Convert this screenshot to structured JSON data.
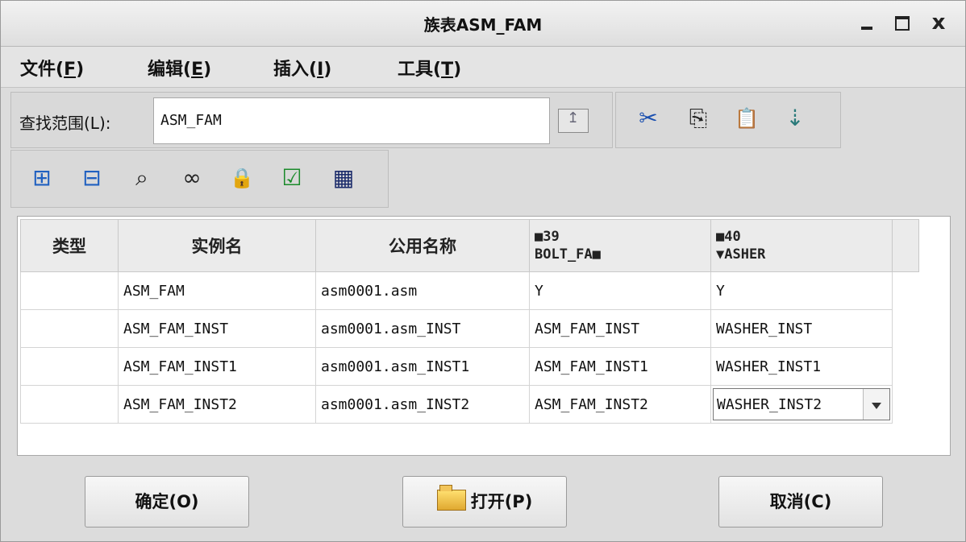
{
  "window": {
    "title": "族表ASM_FAM"
  },
  "menu": [
    {
      "label": "文件(",
      "key": "F",
      "suffix": ")"
    },
    {
      "label": "编辑(",
      "key": "E",
      "suffix": ")"
    },
    {
      "label": "插入(",
      "key": "I",
      "suffix": ")"
    },
    {
      "label": "工具(",
      "key": "T",
      "suffix": ")"
    }
  ],
  "find": {
    "label": "查找范围(L):",
    "value": "ASM_FAM"
  },
  "toolbar_icons": {
    "cut": "✂",
    "copy": "⎘",
    "paste": "📋",
    "verify_tree": "⇣",
    "insert_row": "⊞",
    "insert_col": "⊟",
    "find": "⌕",
    "preview": "∞",
    "lock": "🔒",
    "verify": "☑",
    "table": "▦"
  },
  "table": {
    "headers": {
      "type": "类型",
      "instance_name": "实例名",
      "common_name": "公用名称",
      "f39_line1": "■39",
      "f39_line2": "BOLT_FA■",
      "f40_line1": "■40",
      "f40_line2": "▼ASHER"
    },
    "rows": [
      {
        "type": "",
        "name": "ASM_FAM",
        "common": "asm0001.asm",
        "f39": "Y",
        "f40": "Y"
      },
      {
        "type": "",
        "name": "ASM_FAM_INST",
        "common": "asm0001.asm_INST",
        "f39": "ASM_FAM_INST",
        "f40": "WASHER_INST"
      },
      {
        "type": "",
        "name": "ASM_FAM_INST1",
        "common": "asm0001.asm_INST1",
        "f39": "ASM_FAM_INST1",
        "f40": "WASHER_INST1"
      },
      {
        "type": "",
        "name": "ASM_FAM_INST2",
        "common": "asm0001.asm_INST2",
        "f39": "ASM_FAM_INST2",
        "f40": "WASHER_INST2"
      }
    ]
  },
  "buttons": {
    "ok": "确定(O)",
    "open": "打开(P)",
    "cancel": "取消(C)"
  }
}
